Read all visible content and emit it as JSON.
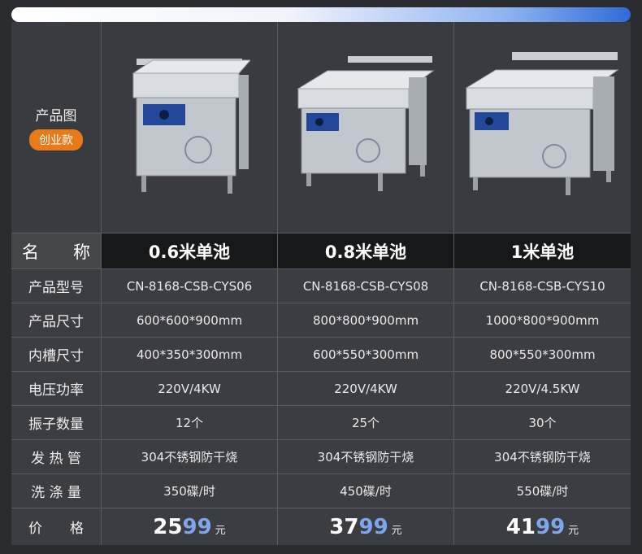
{
  "image_row": {
    "label": "产品图",
    "badge": "创业款"
  },
  "name_row": {
    "label": "名　　称",
    "values": [
      "0.6米单池",
      "0.8米单池",
      "1米单池"
    ]
  },
  "rows": [
    {
      "label": "产品型号",
      "values": [
        "CN-8168-CSB-CYS06",
        "CN-8168-CSB-CYS08",
        "CN-8168-CSB-CYS10"
      ]
    },
    {
      "label": "产品尺寸",
      "values": [
        "600*600*900mm",
        "800*800*900mm",
        "1000*800*900mm"
      ]
    },
    {
      "label": "内槽尺寸",
      "values": [
        "400*350*300mm",
        "600*550*300mm",
        "800*550*300mm"
      ]
    },
    {
      "label": "电压功率",
      "values": [
        "220V/4KW",
        "220V/4KW",
        "220V/4.5KW"
      ]
    },
    {
      "label": "振子数量",
      "values": [
        "12个",
        "25个",
        "30个"
      ]
    },
    {
      "label": "发 热 管",
      "values": [
        "304不锈钢防干烧",
        "304不锈钢防干烧",
        "304不锈钢防干烧"
      ]
    },
    {
      "label": "洗 涤 量",
      "values": [
        "350碟/时",
        "450碟/时",
        "550碟/时"
      ]
    }
  ],
  "price_row": {
    "label": "价　　格",
    "prices": [
      {
        "lead": "25",
        "tail": "99",
        "unit": "元"
      },
      {
        "lead": "37",
        "tail": "99",
        "unit": "元"
      },
      {
        "lead": "41",
        "tail": "99",
        "unit": "元"
      }
    ]
  },
  "colors": {
    "accent_orange": "#e87a1a",
    "price_blue": "#7fa6ec",
    "header_dark": "#17181a"
  }
}
